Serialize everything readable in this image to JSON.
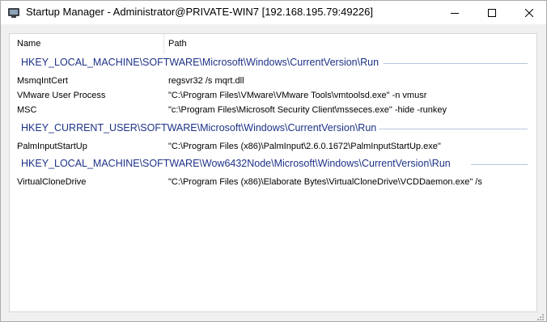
{
  "window": {
    "title": "Startup Manager - Administrator@PRIVATE-WIN7 [192.168.195.79:49226]"
  },
  "listview": {
    "columns": {
      "name": "Name",
      "path": "Path"
    },
    "groups": [
      {
        "label": "HKEY_LOCAL_MACHINE\\SOFTWARE\\Microsoft\\Windows\\CurrentVersion\\Run",
        "rows": [
          {
            "name": "MsmqIntCert",
            "path": "regsvr32 /s mqrt.dll"
          },
          {
            "name": "VMware User Process",
            "path": "\"C:\\Program Files\\VMware\\VMware Tools\\vmtoolsd.exe\" -n vmusr"
          },
          {
            "name": "MSC",
            "path": "\"c:\\Program Files\\Microsoft Security Client\\msseces.exe\" -hide -runkey"
          }
        ]
      },
      {
        "label": "HKEY_CURRENT_USER\\SOFTWARE\\Microsoft\\Windows\\CurrentVersion\\Run",
        "rows": [
          {
            "name": "PalmInputStartUp",
            "path": "\"C:\\Program Files (x86)\\PalmInput\\2.6.0.1672\\PalmInputStartUp.exe\""
          }
        ]
      },
      {
        "label": "HKEY_LOCAL_MACHINE\\SOFTWARE\\Wow6432Node\\Microsoft\\Windows\\CurrentVersion\\Run",
        "rows": [
          {
            "name": "VirtualCloneDrive",
            "path": "\"C:\\Program Files (x86)\\Elaborate Bytes\\VirtualCloneDrive\\VCDDaemon.exe\" /s"
          }
        ]
      }
    ]
  },
  "colors": {
    "group_text": "#1e3287",
    "group_line": "#b8c4de"
  }
}
